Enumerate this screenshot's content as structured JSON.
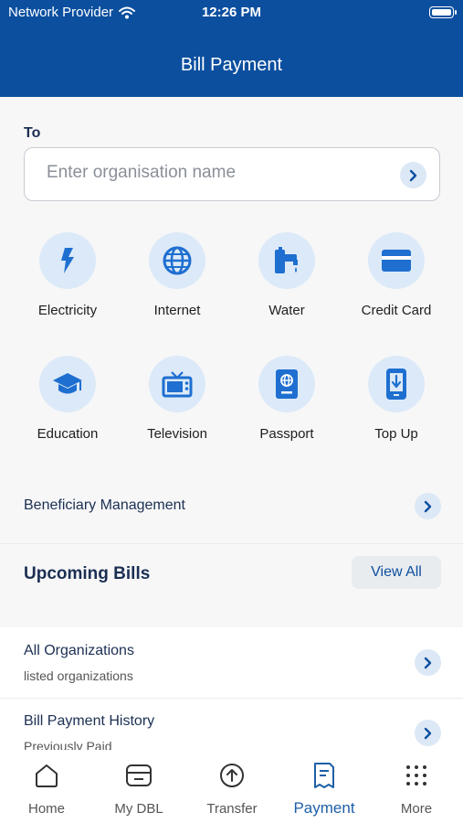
{
  "status": {
    "provider": "Network Provider",
    "time": "12:26 PM"
  },
  "header": {
    "title": "Bill Payment"
  },
  "to": {
    "label": "To",
    "placeholder": "Enter organisation name"
  },
  "categories": [
    {
      "label": "Electricity",
      "icon": "lightning-icon"
    },
    {
      "label": "Internet",
      "icon": "globe-icon"
    },
    {
      "label": "Water",
      "icon": "water-tap-icon"
    },
    {
      "label": "Credit Card",
      "icon": "credit-card-icon"
    },
    {
      "label": "Education",
      "icon": "graduation-cap-icon"
    },
    {
      "label": "Television",
      "icon": "television-icon"
    },
    {
      "label": "Passport",
      "icon": "passport-icon"
    },
    {
      "label": "Top Up",
      "icon": "mobile-topup-icon"
    }
  ],
  "beneficiary": {
    "label": "Beneficiary Management"
  },
  "upcoming": {
    "title": "Upcoming Bills",
    "view_all": "View All"
  },
  "list": [
    {
      "title": "All Organizations",
      "subtitle": "listed organizations"
    },
    {
      "title": "Bill Payment History",
      "subtitle": "Previously Paid"
    }
  ],
  "tabs": [
    {
      "label": "Home",
      "icon": "home-icon"
    },
    {
      "label": "My DBL",
      "icon": "card-icon"
    },
    {
      "label": "Transfer",
      "icon": "transfer-icon"
    },
    {
      "label": "Payment",
      "icon": "receipt-icon",
      "active": true
    },
    {
      "label": "More",
      "icon": "grid-dots-icon"
    }
  ],
  "colors": {
    "brand": "#0c4f9f",
    "accent": "#1e6fd0",
    "icon_bg": "#dce9f8"
  }
}
